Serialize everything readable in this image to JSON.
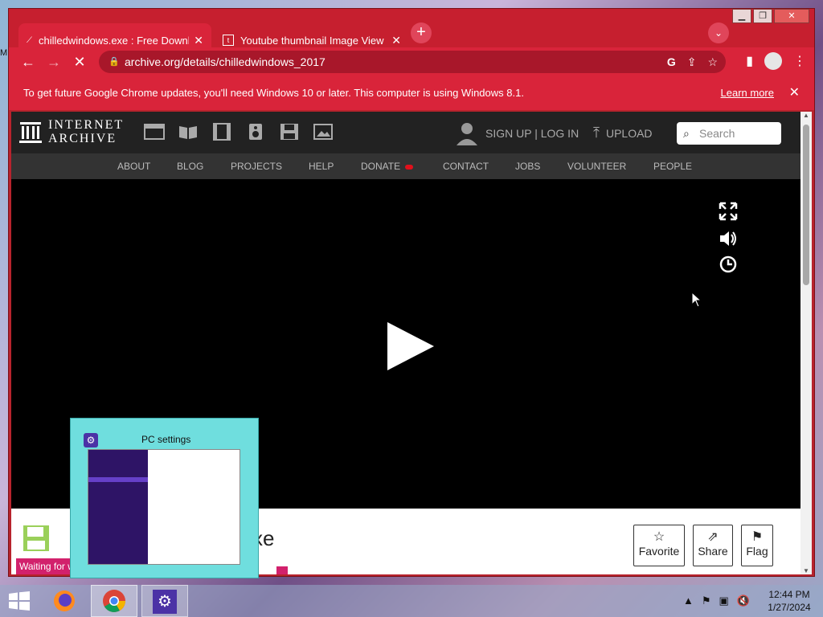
{
  "browser": {
    "tabs": [
      {
        "title": "chilledwindows.exe : Free Downlo",
        "active": true
      },
      {
        "title": "Youtube thumbnail Image View",
        "active": false
      }
    ],
    "new_tab_label": "+",
    "address": "archive.org/details/chilledwindows_2017",
    "infobar": {
      "message": "To get future Google Chrome updates, you'll need Windows 10 or later. This computer is using Windows 8.1.",
      "learn_more": "Learn more",
      "close": "✕"
    },
    "status": "Waiting for w"
  },
  "ia": {
    "logo_line1": "INTERNET",
    "logo_line2": "ARCHIVE",
    "signup": "SIGN UP | LOG IN",
    "upload": "UPLOAD",
    "search_placeholder": "Search",
    "nav": [
      "ABOUT",
      "BLOG",
      "PROJECTS",
      "HELP",
      "DONATE",
      "CONTACT",
      "JOBS",
      "VOLUNTEER",
      "PEOPLE"
    ],
    "title_fragment": "xe",
    "actions": {
      "favorite": "Favorite",
      "share": "Share",
      "flag": "Flag"
    }
  },
  "thumbnail": {
    "title": "PC settings"
  },
  "taskbar": {
    "time": "12:44 PM",
    "date": "1/27/2024"
  },
  "colors": {
    "chrome_frame": "#c61f2f",
    "ia_header": "#222222",
    "thumbnail_bg": "#6fdede",
    "pc_settings_purple": "#2e1466"
  }
}
